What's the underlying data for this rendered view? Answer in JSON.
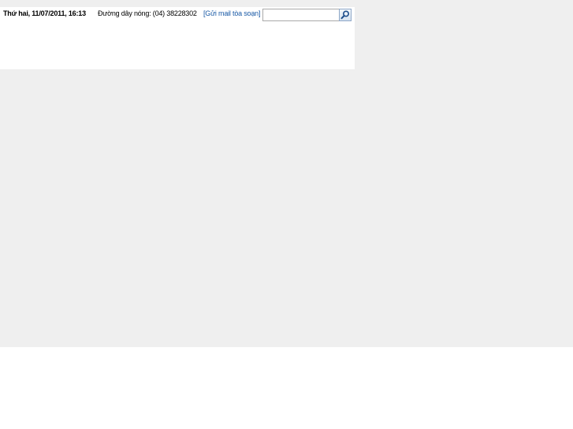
{
  "header": {
    "date_time": "Thứ hai, 11/07/2011, 16:13",
    "hotline": "Đường dây nóng: (04) 38228302",
    "mail_link": "[Gửi mail tòa soạn]"
  },
  "search": {
    "value": "",
    "placeholder": "",
    "button_icon": "search-icon"
  },
  "colors": {
    "background_gray": "#efefef",
    "link_blue": "#1a5aa6"
  }
}
